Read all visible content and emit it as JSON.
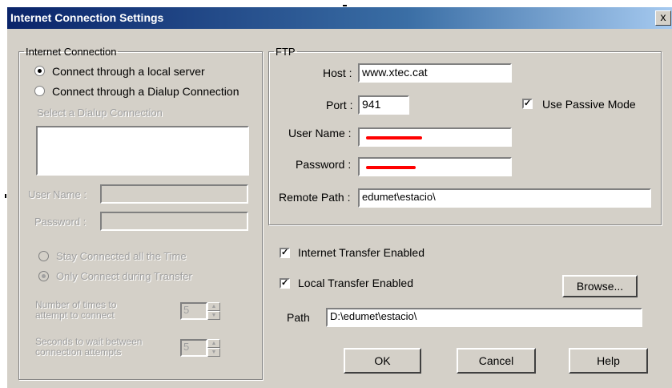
{
  "window": {
    "title": "Internet Connection Settings",
    "close_label": "x"
  },
  "internet_connection": {
    "legend": "Internet Connection",
    "radio_local": "Connect through a local server",
    "radio_dialup": "Connect through a Dialup Connection",
    "select_dialup_label": "Select a Dialup Connection",
    "username_label": "User Name :",
    "password_label": "Password :",
    "stay_connected": "Stay Connected all the Time",
    "only_connect": "Only Connect during Transfer",
    "attempts_label_1": "Number of times to",
    "attempts_label_2": "attempt to connect",
    "attempts_value": "5",
    "wait_label_1": "Seconds to wait between",
    "wait_label_2": "connection attempts",
    "wait_value": "5"
  },
  "ftp": {
    "legend": "FTP",
    "host_label": "Host :",
    "host_value": "www.xtec.cat",
    "port_label": "Port :",
    "port_value": "941",
    "passive_label": "Use Passive Mode",
    "username_label": "User Name :",
    "password_label": "Password :",
    "remote_path_label": "Remote Path :",
    "remote_path_value": "edumet\\estacio\\"
  },
  "transfer": {
    "internet_enabled": "Internet Transfer Enabled",
    "local_enabled": "Local Transfer Enabled",
    "browse": "Browse...",
    "path_label": "Path",
    "path_value": "D:\\edumet\\estacio\\"
  },
  "buttons": {
    "ok": "OK",
    "cancel": "Cancel",
    "help": "Help"
  },
  "colors": {
    "face": "#d4d0c8",
    "title_start": "#0a246a",
    "title_end": "#a6caf0",
    "redaction": "#ff0000"
  }
}
